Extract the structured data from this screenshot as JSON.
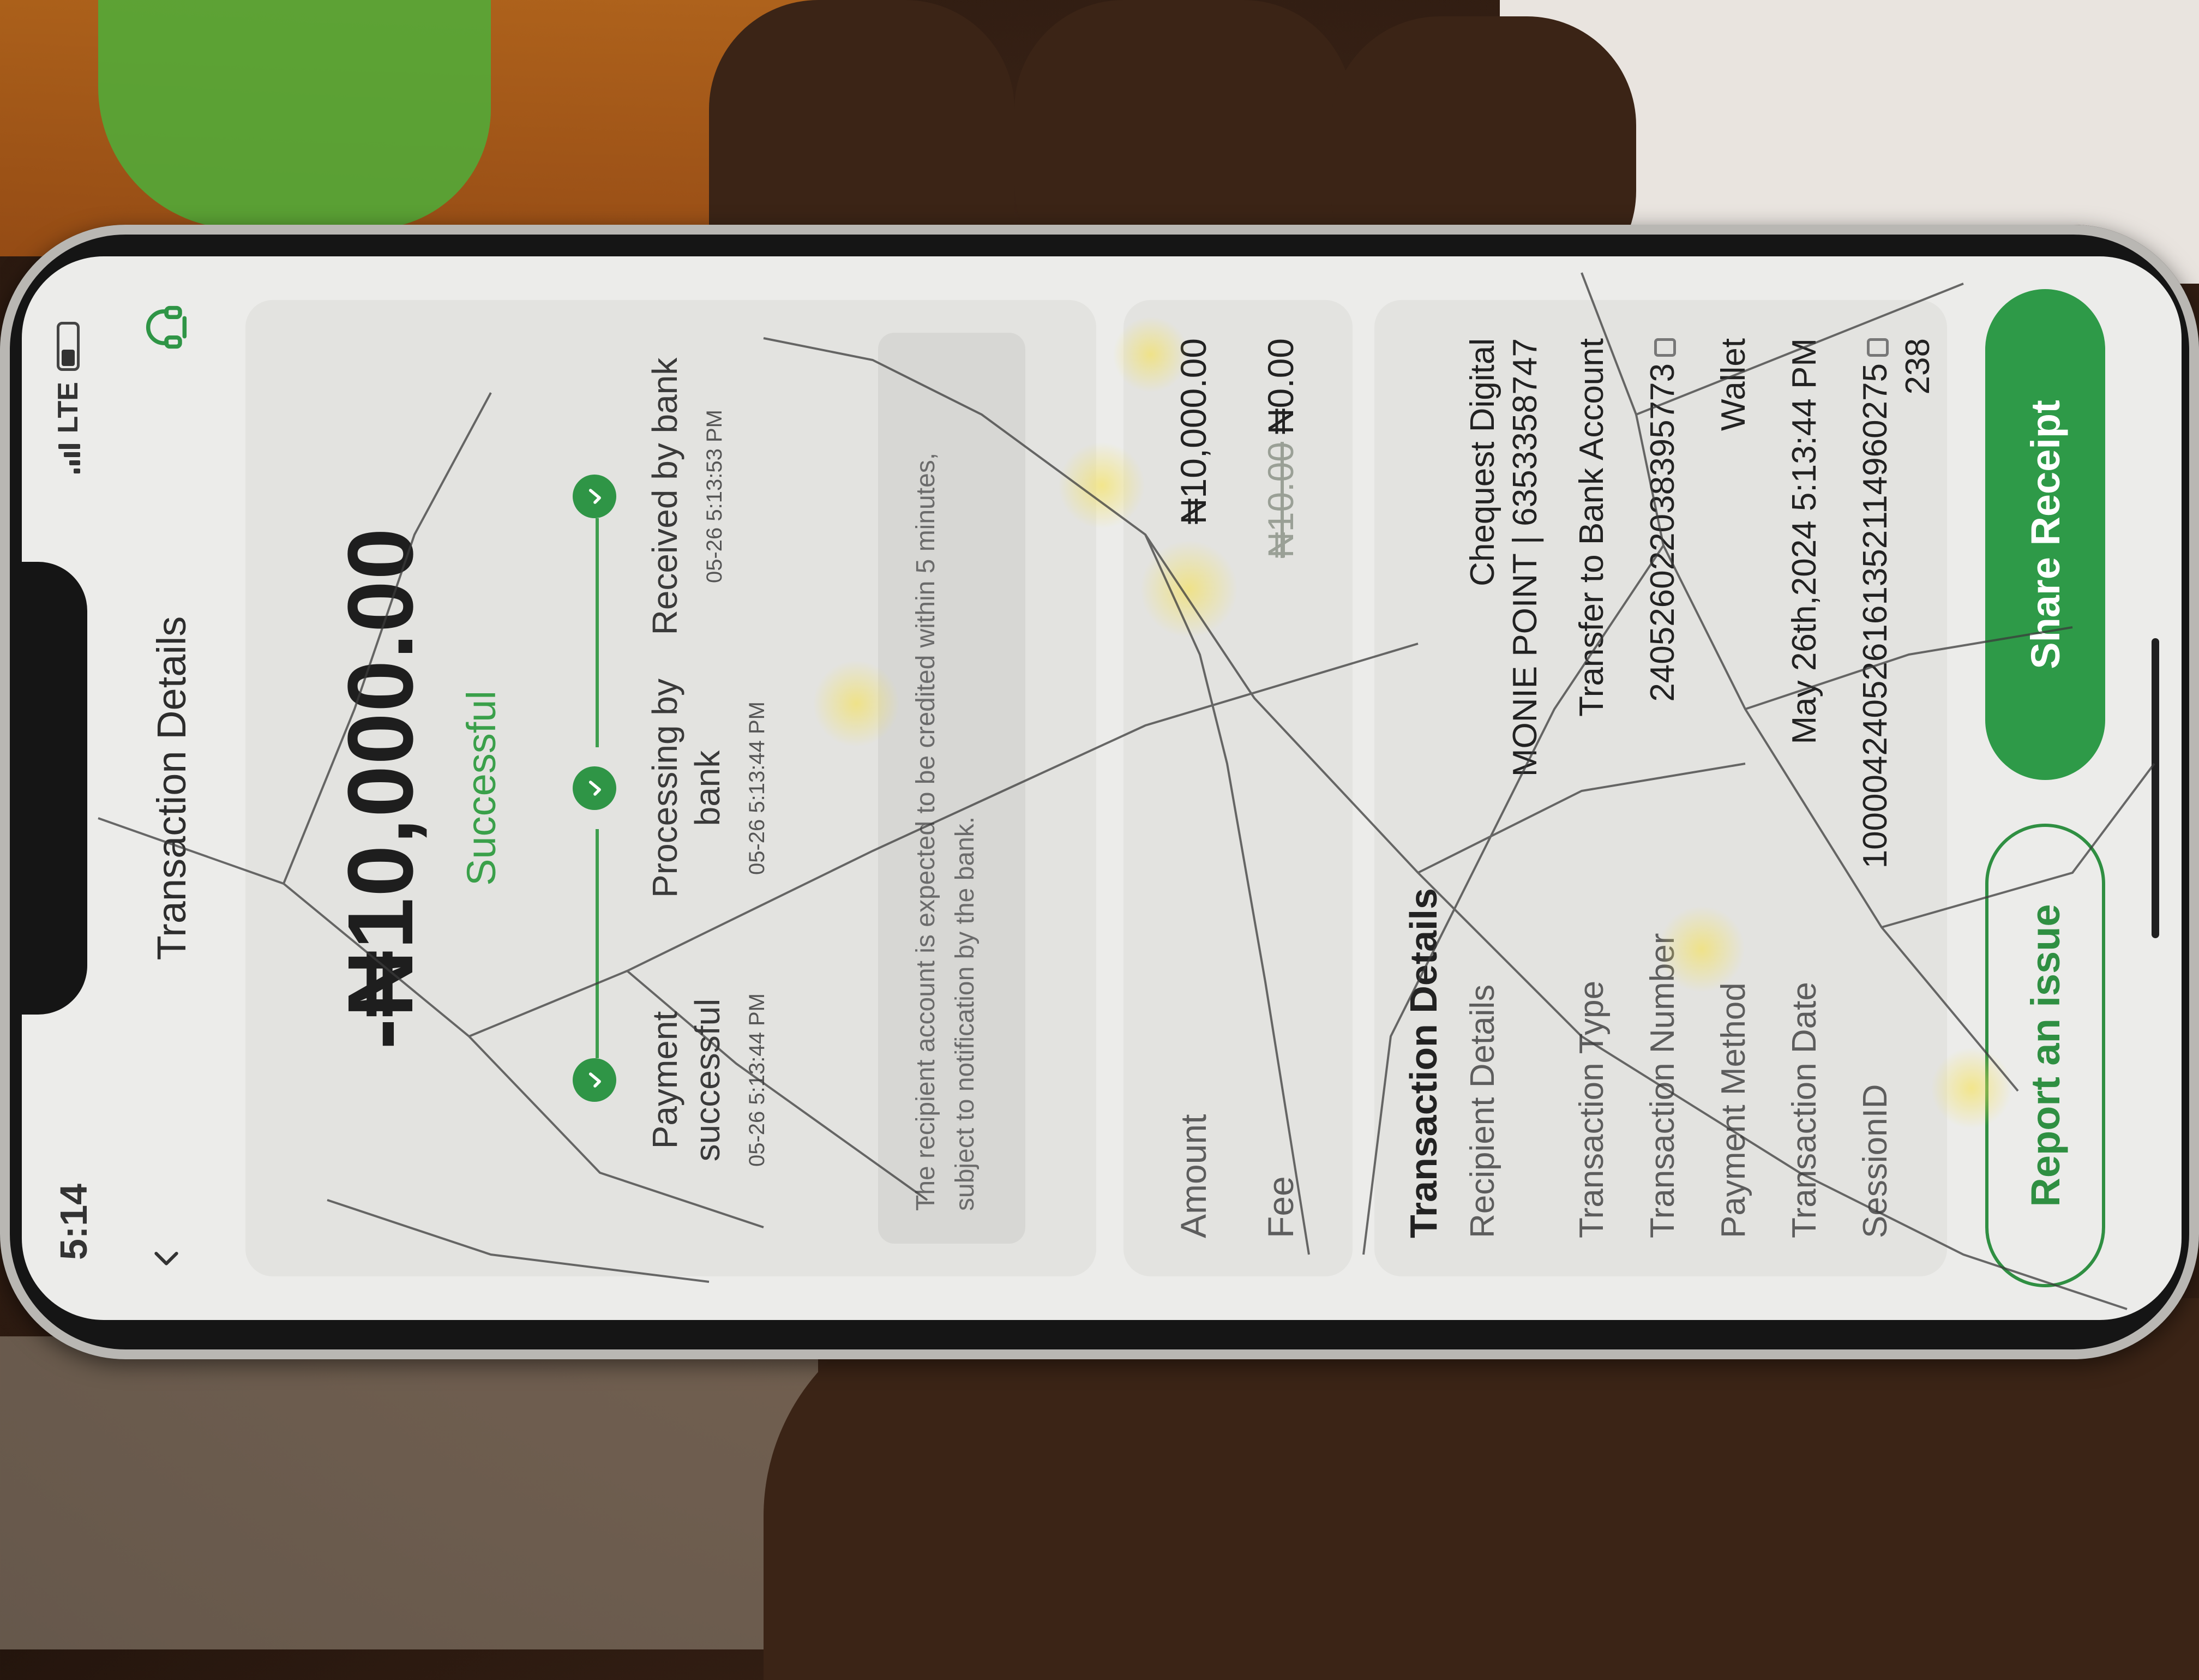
{
  "status_bar": {
    "time": "5:14",
    "network": "LTE"
  },
  "header": {
    "title": "Transaction Details"
  },
  "summary": {
    "amount": "-₦10,000.00",
    "status": "Successful",
    "steps": [
      {
        "title": "Payment successful",
        "time": "05-26 5:13:44 PM"
      },
      {
        "title": "Processing by bank",
        "time": "05-26 5:13:44 PM"
      },
      {
        "title": "Received by bank",
        "time": "05-26 5:13:53 PM"
      }
    ],
    "notice": "The recipient account is expected to be credited within 5 minutes, subject to notification by the bank."
  },
  "charges": {
    "amount_label": "Amount",
    "amount_value": "₦10,000.00",
    "fee_label": "Fee",
    "fee_original": "₦10.00",
    "fee_value": "₦0.00"
  },
  "details": {
    "title": "Transaction Details",
    "recipient_label": "Recipient Details",
    "recipient_name": "Chequest Digital",
    "recipient_account": "MONIE POINT | 6353358747",
    "type_label": "Transaction Type",
    "type_value": "Transfer to Bank Account",
    "number_label": "Transaction Number",
    "number_value": "240526022038395773",
    "method_label": "Payment Method",
    "method_value": "Wallet",
    "date_label": "Transaction Date",
    "date_value": "May 26th,2024 5:13:44 PM",
    "session_label": "SessionID",
    "session_value": "100004240526161352114960275",
    "session_value_cont": "238"
  },
  "actions": {
    "report_label": "Report an issue",
    "share_label": "Share Receipt"
  },
  "colors": {
    "accent": "#2e9a48",
    "success_text": "#3aa04a",
    "screen_bg": "#ececea",
    "card_bg": "#e3e3e0"
  }
}
